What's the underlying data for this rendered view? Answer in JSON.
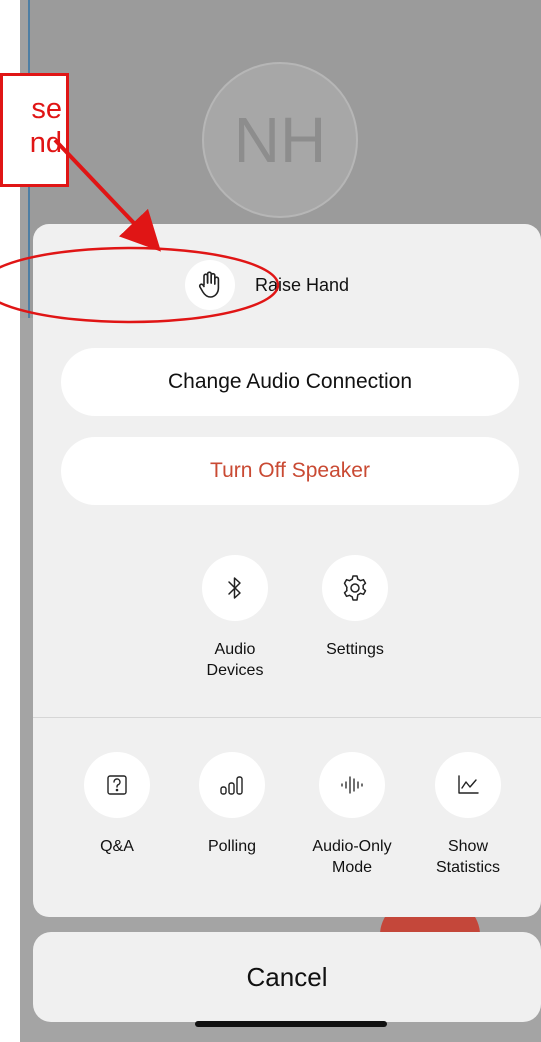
{
  "background": {
    "avatar_initials": "NH"
  },
  "annotation": {
    "callout_line1": "se",
    "callout_line2": "nd",
    "color": "#e01515"
  },
  "sheet": {
    "raise_hand": {
      "label": "Raise Hand",
      "icon": "raised-hand-icon"
    },
    "change_audio_label": "Change Audio Connection",
    "turn_off_speaker_label": "Turn Off Speaker",
    "speaker_color": "#c94a33",
    "row1": [
      {
        "label": "Audio\nDevices",
        "icon": "bluetooth-icon"
      },
      {
        "label": "Settings",
        "icon": "gear-icon"
      }
    ],
    "row2": [
      {
        "label": "Q&A",
        "icon": "question-box-icon"
      },
      {
        "label": "Polling",
        "icon": "bar-chart-icon"
      },
      {
        "label": "Audio-Only\nMode",
        "icon": "audio-waveform-icon"
      },
      {
        "label": "Show\nStatistics",
        "icon": "line-chart-icon"
      }
    ]
  },
  "cancel_label": "Cancel"
}
